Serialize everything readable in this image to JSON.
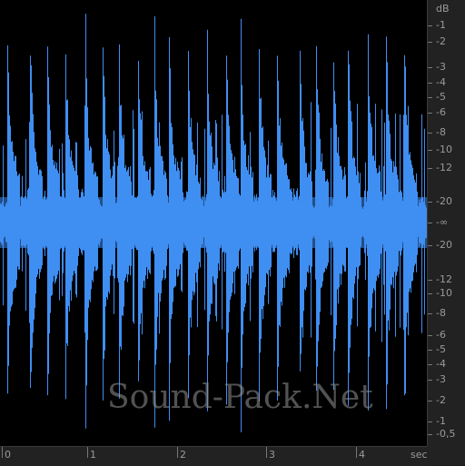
{
  "colors": {
    "waveform": "#3f8ef2",
    "background": "#000000",
    "ruler_text": "#9a9a9a"
  },
  "db_ruler": {
    "unit": "dB",
    "labels": [
      "-1",
      "-2",
      "-3",
      "-4",
      "-5",
      "-6",
      "-8",
      "-10",
      "-12",
      "-20",
      "-∞",
      "-20",
      "-12",
      "-10",
      "-8",
      "-6",
      "-5",
      "-4",
      "-3",
      "-2",
      "-1",
      "-0,5"
    ]
  },
  "time_ruler": {
    "labels": [
      "0",
      "1",
      "2",
      "3",
      "4"
    ],
    "unit": "sec"
  },
  "watermark": "Sound-Pack.Net"
}
